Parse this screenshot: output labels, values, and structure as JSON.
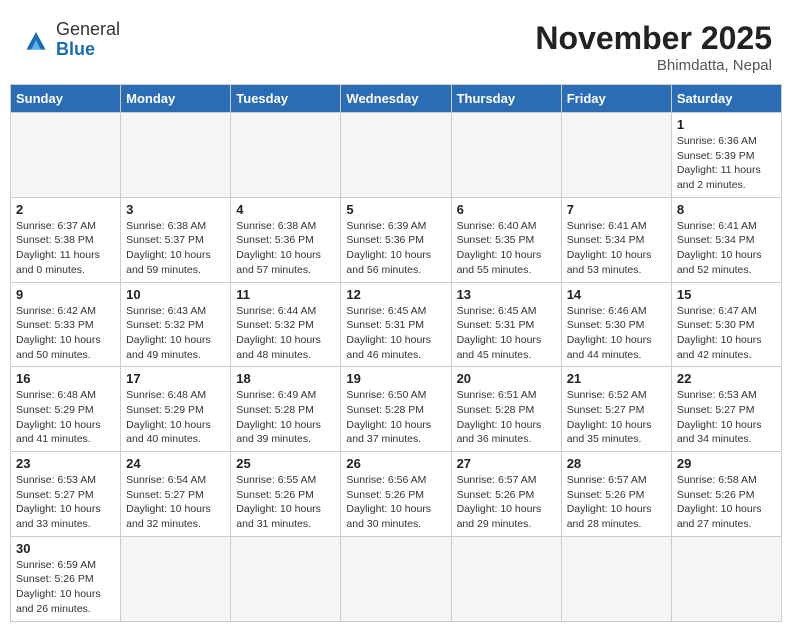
{
  "header": {
    "logo_general": "General",
    "logo_blue": "Blue",
    "month_title": "November 2025",
    "location": "Bhimdatta, Nepal"
  },
  "weekdays": [
    "Sunday",
    "Monday",
    "Tuesday",
    "Wednesday",
    "Thursday",
    "Friday",
    "Saturday"
  ],
  "weeks": [
    [
      {
        "day": "",
        "info": ""
      },
      {
        "day": "",
        "info": ""
      },
      {
        "day": "",
        "info": ""
      },
      {
        "day": "",
        "info": ""
      },
      {
        "day": "",
        "info": ""
      },
      {
        "day": "",
        "info": ""
      },
      {
        "day": "1",
        "info": "Sunrise: 6:36 AM\nSunset: 5:39 PM\nDaylight: 11 hours\nand 2 minutes."
      }
    ],
    [
      {
        "day": "2",
        "info": "Sunrise: 6:37 AM\nSunset: 5:38 PM\nDaylight: 11 hours\nand 0 minutes."
      },
      {
        "day": "3",
        "info": "Sunrise: 6:38 AM\nSunset: 5:37 PM\nDaylight: 10 hours\nand 59 minutes."
      },
      {
        "day": "4",
        "info": "Sunrise: 6:38 AM\nSunset: 5:36 PM\nDaylight: 10 hours\nand 57 minutes."
      },
      {
        "day": "5",
        "info": "Sunrise: 6:39 AM\nSunset: 5:36 PM\nDaylight: 10 hours\nand 56 minutes."
      },
      {
        "day": "6",
        "info": "Sunrise: 6:40 AM\nSunset: 5:35 PM\nDaylight: 10 hours\nand 55 minutes."
      },
      {
        "day": "7",
        "info": "Sunrise: 6:41 AM\nSunset: 5:34 PM\nDaylight: 10 hours\nand 53 minutes."
      },
      {
        "day": "8",
        "info": "Sunrise: 6:41 AM\nSunset: 5:34 PM\nDaylight: 10 hours\nand 52 minutes."
      }
    ],
    [
      {
        "day": "9",
        "info": "Sunrise: 6:42 AM\nSunset: 5:33 PM\nDaylight: 10 hours\nand 50 minutes."
      },
      {
        "day": "10",
        "info": "Sunrise: 6:43 AM\nSunset: 5:32 PM\nDaylight: 10 hours\nand 49 minutes."
      },
      {
        "day": "11",
        "info": "Sunrise: 6:44 AM\nSunset: 5:32 PM\nDaylight: 10 hours\nand 48 minutes."
      },
      {
        "day": "12",
        "info": "Sunrise: 6:45 AM\nSunset: 5:31 PM\nDaylight: 10 hours\nand 46 minutes."
      },
      {
        "day": "13",
        "info": "Sunrise: 6:45 AM\nSunset: 5:31 PM\nDaylight: 10 hours\nand 45 minutes."
      },
      {
        "day": "14",
        "info": "Sunrise: 6:46 AM\nSunset: 5:30 PM\nDaylight: 10 hours\nand 44 minutes."
      },
      {
        "day": "15",
        "info": "Sunrise: 6:47 AM\nSunset: 5:30 PM\nDaylight: 10 hours\nand 42 minutes."
      }
    ],
    [
      {
        "day": "16",
        "info": "Sunrise: 6:48 AM\nSunset: 5:29 PM\nDaylight: 10 hours\nand 41 minutes."
      },
      {
        "day": "17",
        "info": "Sunrise: 6:48 AM\nSunset: 5:29 PM\nDaylight: 10 hours\nand 40 minutes."
      },
      {
        "day": "18",
        "info": "Sunrise: 6:49 AM\nSunset: 5:28 PM\nDaylight: 10 hours\nand 39 minutes."
      },
      {
        "day": "19",
        "info": "Sunrise: 6:50 AM\nSunset: 5:28 PM\nDaylight: 10 hours\nand 37 minutes."
      },
      {
        "day": "20",
        "info": "Sunrise: 6:51 AM\nSunset: 5:28 PM\nDaylight: 10 hours\nand 36 minutes."
      },
      {
        "day": "21",
        "info": "Sunrise: 6:52 AM\nSunset: 5:27 PM\nDaylight: 10 hours\nand 35 minutes."
      },
      {
        "day": "22",
        "info": "Sunrise: 6:53 AM\nSunset: 5:27 PM\nDaylight: 10 hours\nand 34 minutes."
      }
    ],
    [
      {
        "day": "23",
        "info": "Sunrise: 6:53 AM\nSunset: 5:27 PM\nDaylight: 10 hours\nand 33 minutes."
      },
      {
        "day": "24",
        "info": "Sunrise: 6:54 AM\nSunset: 5:27 PM\nDaylight: 10 hours\nand 32 minutes."
      },
      {
        "day": "25",
        "info": "Sunrise: 6:55 AM\nSunset: 5:26 PM\nDaylight: 10 hours\nand 31 minutes."
      },
      {
        "day": "26",
        "info": "Sunrise: 6:56 AM\nSunset: 5:26 PM\nDaylight: 10 hours\nand 30 minutes."
      },
      {
        "day": "27",
        "info": "Sunrise: 6:57 AM\nSunset: 5:26 PM\nDaylight: 10 hours\nand 29 minutes."
      },
      {
        "day": "28",
        "info": "Sunrise: 6:57 AM\nSunset: 5:26 PM\nDaylight: 10 hours\nand 28 minutes."
      },
      {
        "day": "29",
        "info": "Sunrise: 6:58 AM\nSunset: 5:26 PM\nDaylight: 10 hours\nand 27 minutes."
      }
    ],
    [
      {
        "day": "30",
        "info": "Sunrise: 6:59 AM\nSunset: 5:26 PM\nDaylight: 10 hours\nand 26 minutes."
      },
      {
        "day": "",
        "info": ""
      },
      {
        "day": "",
        "info": ""
      },
      {
        "day": "",
        "info": ""
      },
      {
        "day": "",
        "info": ""
      },
      {
        "day": "",
        "info": ""
      },
      {
        "day": "",
        "info": ""
      }
    ]
  ]
}
